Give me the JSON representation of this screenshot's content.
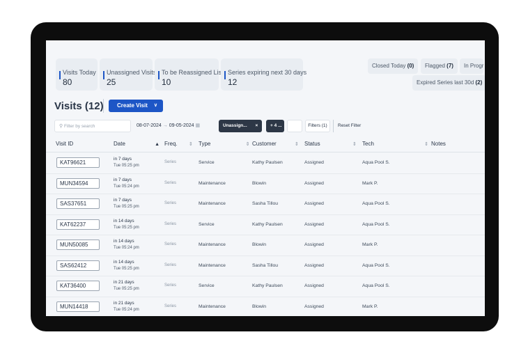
{
  "stats": [
    {
      "label": "Visits Today",
      "value": "80"
    },
    {
      "label": "Unassigned Visits",
      "value": "25"
    },
    {
      "label": "To be Reassigned List",
      "value": "10"
    },
    {
      "label": "Series expiring next 30 days",
      "value": "12"
    }
  ],
  "pills": {
    "closed": {
      "label": "Closed Today",
      "count": "(0)"
    },
    "flagged": {
      "label": "Flagged",
      "count": "(7)"
    },
    "inprogress": {
      "label": "In Progr"
    },
    "expired": {
      "label": "Expired Series last 30d",
      "count": "(2)"
    }
  },
  "title": "Visits",
  "count": "(12)",
  "create_label": "Create Visit",
  "search_placeholder": "Filter by search",
  "date_start": "08-07-2024",
  "date_arrow": "→",
  "date_end": "09-05-2024",
  "chip_unassigned": "Unassign...",
  "chip_close": "×",
  "chip_more": "+ 4 ...",
  "filters_label": "Filters (1)",
  "reset_label": "Reset Filter",
  "columns": {
    "visit_id": "Visit ID",
    "date": "Date",
    "freq": "Freq.",
    "type": "Type",
    "customer": "Customer",
    "status": "Status",
    "tech": "Tech",
    "notes": "Notes"
  },
  "rows": [
    {
      "id": "KAT96621",
      "rel": "in 7 days",
      "time": "Tue 05:25 pm",
      "freq": "Series",
      "type": "Service",
      "customer": "Kathy Paulsen",
      "status": "Assigned",
      "tech": "Aqua Pool S."
    },
    {
      "id": "MUN34594",
      "rel": "in 7 days",
      "time": "Tue 05:24 pm",
      "freq": "Series",
      "type": "Maintenance",
      "customer": "Blowin",
      "status": "Assigned",
      "tech": "Mark P."
    },
    {
      "id": "SAS37651",
      "rel": "in 7 days",
      "time": "Tue 05:25 pm",
      "freq": "Series",
      "type": "Maintenance",
      "customer": "Sasha Tillou",
      "status": "Assigned",
      "tech": "Aqua Pool S."
    },
    {
      "id": "KAT62237",
      "rel": "in 14 days",
      "time": "Tue 05:25 pm",
      "freq": "Series",
      "type": "Service",
      "customer": "Kathy Paulsen",
      "status": "Assigned",
      "tech": "Aqua Pool S."
    },
    {
      "id": "MUN50085",
      "rel": "in 14 days",
      "time": "Tue 05:24 pm",
      "freq": "Series",
      "type": "Maintenance",
      "customer": "Blowin",
      "status": "Assigned",
      "tech": "Mark P."
    },
    {
      "id": "SAS62412",
      "rel": "in 14 days",
      "time": "Tue 05:25 pm",
      "freq": "Series",
      "type": "Maintenance",
      "customer": "Sasha Tillou",
      "status": "Assigned",
      "tech": "Aqua Pool S."
    },
    {
      "id": "KAT36400",
      "rel": "in 21 days",
      "time": "Tue 05:25 pm",
      "freq": "Series",
      "type": "Service",
      "customer": "Kathy Paulsen",
      "status": "Assigned",
      "tech": "Aqua Pool S."
    },
    {
      "id": "MUN14418",
      "rel": "in 21 days",
      "time": "Tue 05:24 pm",
      "freq": "Series",
      "type": "Maintenance",
      "customer": "Blowin",
      "status": "Assigned",
      "tech": "Mark P."
    }
  ],
  "colors": {
    "accent": "#1d56c6",
    "chip": "#2d3746",
    "frame": "#0d0d0d"
  }
}
